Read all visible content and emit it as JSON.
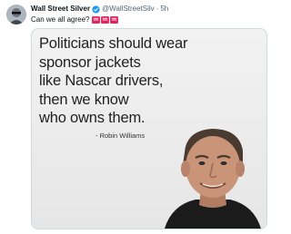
{
  "tweet": {
    "author_name": "Wall Street Silver",
    "handle": "@WallStreetSilv",
    "separator": "·",
    "time": "5h",
    "text": "Can we all agree?",
    "emoji_icons": [
      "red-flag-icon",
      "red-flag-icon",
      "red-flag-icon"
    ]
  },
  "media": {
    "quote_lines": [
      "Politicians should wear",
      "sponsor jackets",
      "like Nascar drivers,",
      "then we know",
      "who owns them."
    ],
    "attribution": "- Robin Williams"
  },
  "colors": {
    "verified_blue": "#1d9bf0",
    "flag_red": "#e0245e",
    "text_primary": "#0f1419",
    "text_secondary": "#536471"
  }
}
